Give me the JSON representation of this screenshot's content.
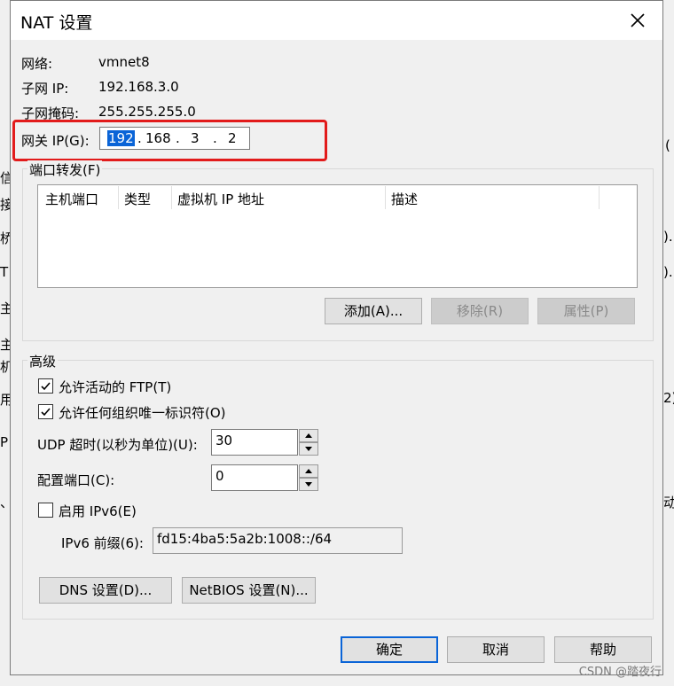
{
  "dialog": {
    "title": "NAT 设置",
    "network_label": "网络:",
    "network_value": "vmnet8",
    "subnet_ip_label": "子网 IP:",
    "subnet_ip_value": "192.168.3.0",
    "subnet_mask_label": "子网掩码:",
    "subnet_mask_value": "255.255.255.0",
    "gateway_label": "网关 IP(G):",
    "gateway_octets": [
      "192",
      "168",
      "3",
      "2"
    ],
    "gateway_dot": "."
  },
  "port_forwarding": {
    "group_label": "端口转发(F)",
    "columns": [
      "主机端口",
      "类型",
      "虚拟机 IP 地址",
      "描述"
    ],
    "add_button": "添加(A)...",
    "remove_button": "移除(R)",
    "properties_button": "属性(P)"
  },
  "advanced": {
    "group_label": "高级",
    "allow_ftp_label": "允许活动的 FTP(T)",
    "allow_ftp_checked": true,
    "allow_oui_label": "允许任何组织唯一标识符(O)",
    "allow_oui_checked": true,
    "udp_timeout_label": "UDP 超时(以秒为单位)(U):",
    "udp_timeout_value": "30",
    "config_port_label": "配置端口(C):",
    "config_port_value": "0",
    "enable_ipv6_label": "启用 IPv6(E)",
    "enable_ipv6_checked": false,
    "ipv6_prefix_label": "IPv6 前缀(6):",
    "ipv6_prefix_value": "fd15:4ba5:5a2b:1008::/64",
    "dns_button": "DNS 设置(D)...",
    "netbios_button": "NetBIOS 设置(N)..."
  },
  "footer": {
    "ok_button": "确定",
    "cancel_button": "取消",
    "help_button": "帮助"
  },
  "background_fragments": {
    "right_1": "(",
    "right_2": ")..",
    "right_3": ")..",
    "right_4": "2)",
    "right_5": "动"
  },
  "watermark": "CSDN @踏夜行",
  "colors": {
    "highlight": "#e21b1b",
    "selection": "#0a64d7"
  }
}
